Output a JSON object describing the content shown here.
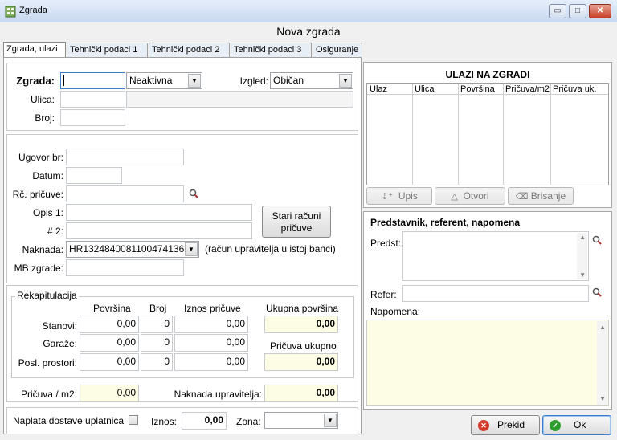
{
  "window": {
    "title": "Zgrada",
    "minimize_glyph": "▭",
    "maximize_glyph": "□",
    "close_glyph": "✕",
    "app_icon": "building-icon"
  },
  "heading": "Nova zgrada",
  "tabs": [
    {
      "label": "Zgrada, ulazi",
      "active": true
    },
    {
      "label": "Tehnički podaci 1",
      "active": false
    },
    {
      "label": "Tehnički podaci 2",
      "active": false
    },
    {
      "label": "Tehnički podaci 3",
      "active": false
    },
    {
      "label": "Osiguranje",
      "active": false
    }
  ],
  "building": {
    "zgrada_label": "Zgrada:",
    "zgrada_value": "",
    "status_value": "Neaktivna",
    "izgled_label": "Izgled:",
    "izgled_value": "Običan",
    "ulica_label": "Ulica:",
    "ulica_value": "",
    "ulica_name": "",
    "broj_label": "Broj:",
    "broj_value": ""
  },
  "contract": {
    "ugovor_label": "Ugovor br:",
    "ugovor_value": "",
    "datum_label": "Datum:",
    "datum_value": "",
    "rc_label": "Rč. pričuve:",
    "rc_value": "",
    "opis1_label": "Opis 1:",
    "opis1_value": "",
    "opis2_label": "# 2:",
    "opis2_value": "",
    "stari_racuni_line1": "Stari računi",
    "stari_racuni_line2": "pričuve",
    "naknada_label": "Naknada:",
    "naknada_value": "HR1324840081100474136",
    "naknada_note": "(račun upravitelja u istoj banci)",
    "mb_label": "MB zgrade:",
    "mb_value": ""
  },
  "recap": {
    "legend": "Rekapitulacija",
    "col_povrsina": "Površina",
    "col_broj": "Broj",
    "col_iznos": "Iznos pričuve",
    "col_ukupna": "Ukupna površina",
    "pricuva_ukupno_label": "Pričuva ukupno",
    "rows": [
      {
        "label": "Stanovi:",
        "povrsina": "0,00",
        "broj": "0",
        "iznos": "0,00"
      },
      {
        "label": "Garaže:",
        "povrsina": "0,00",
        "broj": "0",
        "iznos": "0,00"
      },
      {
        "label": "Posl. prostori:",
        "povrsina": "0,00",
        "broj": "0",
        "iznos": "0,00"
      }
    ],
    "ukupna_povrsina": "0,00",
    "pricuva_ukupno": "0,00"
  },
  "fees": {
    "pricuva_m2_label": "Pričuva / m2:",
    "pricuva_m2_value": "0,00",
    "naknada_upr_label": "Naknada upravitelja:",
    "naknada_upr_value": "0,00"
  },
  "delivery": {
    "naplata_label": "Naplata dostave uplatnica",
    "iznos_label": "Iznos:",
    "iznos_value": "0,00",
    "zona_label": "Zona:",
    "zona_value": ""
  },
  "entrances": {
    "title": "ULAZI NA ZGRADI",
    "columns": [
      "Ulaz",
      "Ulica",
      "Površina",
      "Pričuva/m2",
      "Pričuva uk."
    ],
    "rows": [],
    "upis_label": "Upis",
    "otvori_label": "Otvori",
    "brisanje_label": "Brisanje"
  },
  "representative": {
    "title": "Predstavnik, referent, napomena",
    "predst_label": "Predst:",
    "predst_value": "",
    "refer_label": "Refer:",
    "refer_value": "",
    "napomena_label": "Napomena:",
    "napomena_value": ""
  },
  "actions": {
    "cancel_label": "Prekid",
    "ok_label": "Ok"
  },
  "colors": {
    "accent": "#3b7fd0",
    "highlight_field": "#fdfde6",
    "cancel_red": "#d23a2a",
    "ok_green": "#2f9e2f"
  }
}
